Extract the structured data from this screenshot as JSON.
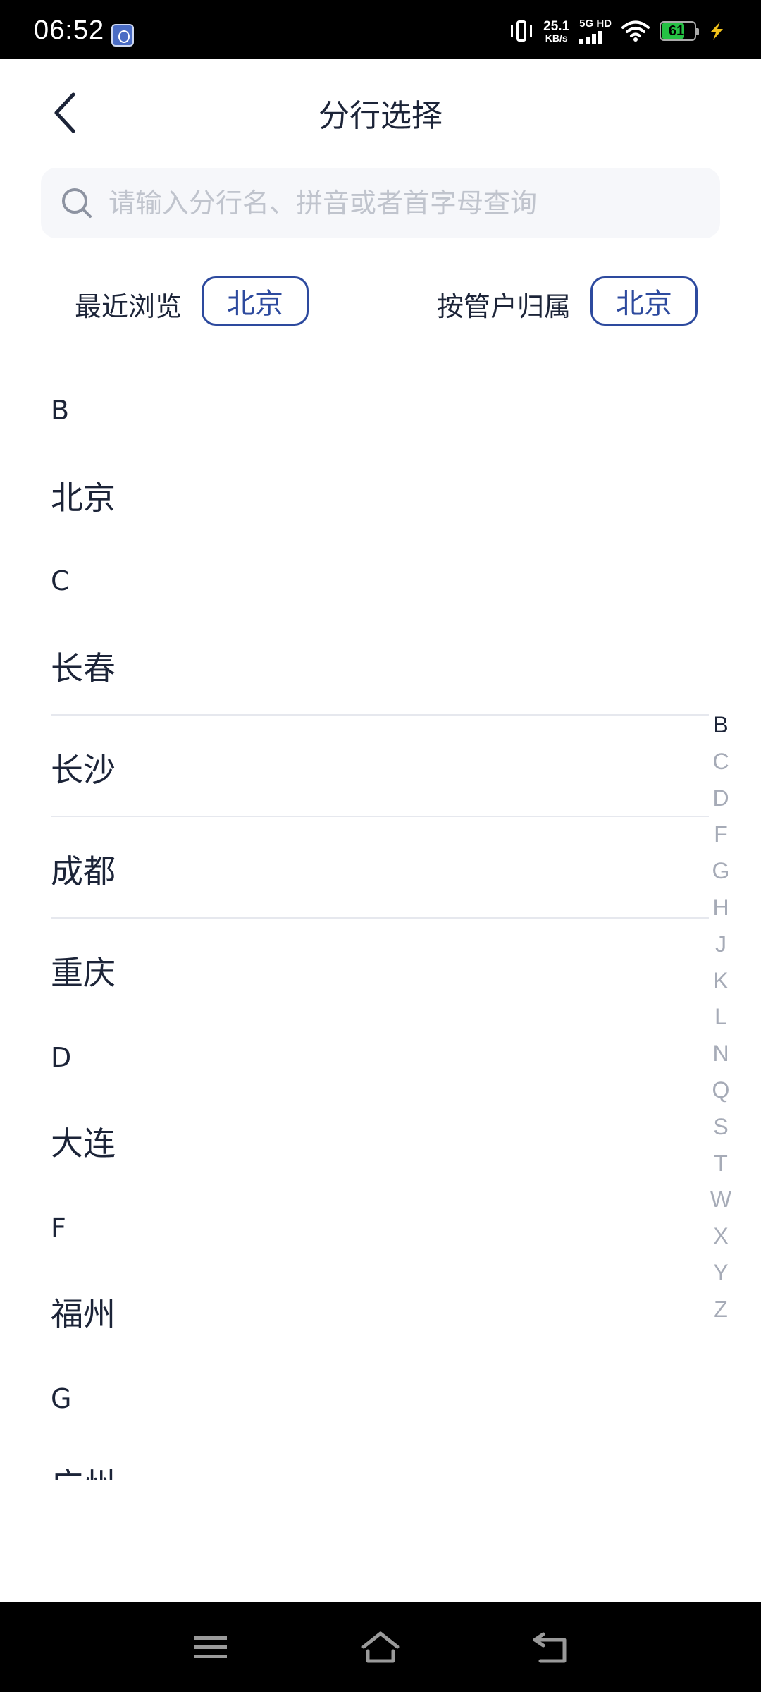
{
  "status_bar": {
    "time": "06:52",
    "net_speed_value": "25.1",
    "net_speed_unit": "KB/s",
    "network_label": "5G HD",
    "battery_level": "61"
  },
  "header": {
    "title": "分行选择"
  },
  "search": {
    "placeholder": "请输入分行名、拼音或者首字母查询"
  },
  "quick": {
    "recent_label": "最近浏览",
    "recent_value": "北京",
    "owner_label": "按管户归属",
    "owner_value": "北京"
  },
  "list": {
    "sections": [
      {
        "letter": "B",
        "cities": [
          "北京"
        ]
      },
      {
        "letter": "C",
        "cities": [
          "长春",
          "长沙",
          "成都",
          "重庆"
        ]
      },
      {
        "letter": "D",
        "cities": [
          "大连"
        ]
      },
      {
        "letter": "F",
        "cities": [
          "福州"
        ]
      },
      {
        "letter": "G",
        "cities": [
          "广州"
        ]
      }
    ]
  },
  "index": {
    "letters": [
      "B",
      "C",
      "D",
      "F",
      "G",
      "H",
      "J",
      "K",
      "L",
      "N",
      "Q",
      "S",
      "T",
      "W",
      "X",
      "Y",
      "Z"
    ],
    "active": "B"
  },
  "colors": {
    "accent": "#2d4a9e",
    "text": "#1c2438",
    "muted": "#a6abb7",
    "search_bg": "#f6f7fa"
  }
}
